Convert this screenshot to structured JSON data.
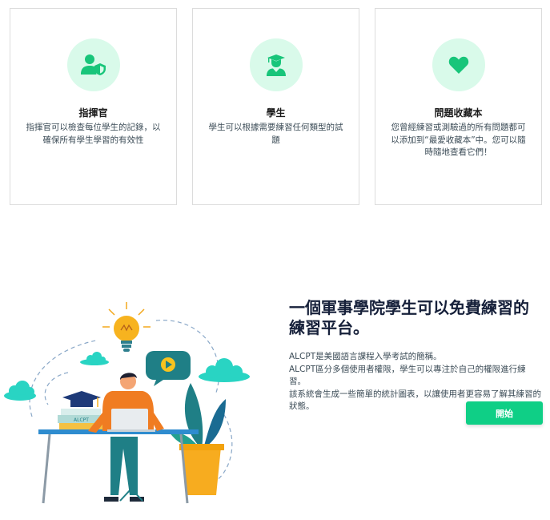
{
  "cards": [
    {
      "title": "指揮官",
      "desc": "指揮官可以檢查每位學生的記錄，以確保所有學生學習的有效性",
      "icon": "user-shield-icon"
    },
    {
      "title": "學生",
      "desc": "學生可以根據需要練習任何類型的試題",
      "icon": "graduate-icon"
    },
    {
      "title": "問題收藏本",
      "desc": "您曾經練習或測驗過的所有問題都可以添加到“最愛收藏本”中。您可以隨時隨地查看它們！",
      "icon": "heart-icon"
    }
  ],
  "hero": {
    "title": "一個軍事學院學生可以免費練習的練習平台。",
    "paragraphs": [
      "ALCPT是美國語言課程入學考試的簡稱。",
      "ALCPT區分多個使用者權限，學生可以專注於自己的權限進行練習。",
      "該系統會生成一些簡單的統計圖表，以讓使用者更容易了解其練習的狀態。"
    ],
    "button_label": "開始",
    "book_label": "ALCPT"
  },
  "colors": {
    "accent": "#0fcf86",
    "icon_green": "#18c57a",
    "circle_bg": "#d9faea",
    "orange": "#f07c22",
    "teal": "#1f7f86"
  }
}
